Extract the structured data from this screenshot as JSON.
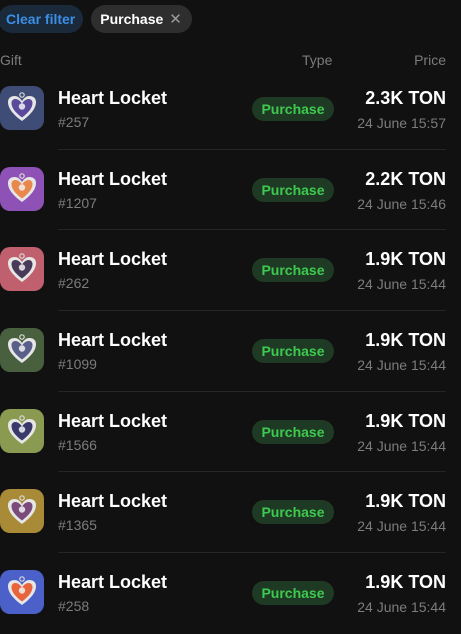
{
  "filters": {
    "clear_label": "Clear filter",
    "active_label": "Purchase",
    "remove_symbol": "✕"
  },
  "table": {
    "headers": {
      "gift": "Gift",
      "type": "Type",
      "price": "Price"
    },
    "rows": [
      {
        "name": "Heart Locket",
        "number": "#257",
        "type": "Purchase",
        "price": "2.3K TON",
        "date": "24 June 15:57",
        "thumb_bg": "#3f4c75",
        "heart": "#5a4a9c"
      },
      {
        "name": "Heart Locket",
        "number": "#1207",
        "type": "Purchase",
        "price": "2.2K TON",
        "date": "24 June 15:46",
        "thumb_bg": "#8e52b6",
        "heart": "#e8884c"
      },
      {
        "name": "Heart Locket",
        "number": "#262",
        "type": "Purchase",
        "price": "1.9K TON",
        "date": "24 June 15:44",
        "thumb_bg": "#c0606e",
        "heart": "#4a3a5a"
      },
      {
        "name": "Heart Locket",
        "number": "#1099",
        "type": "Purchase",
        "price": "1.9K TON",
        "date": "24 June 15:44",
        "thumb_bg": "#49603f",
        "heart": "#5a5f8a"
      },
      {
        "name": "Heart Locket",
        "number": "#1566",
        "type": "Purchase",
        "price": "1.9K TON",
        "date": "24 June 15:44",
        "thumb_bg": "#8a9a50",
        "heart": "#3a3a6a"
      },
      {
        "name": "Heart Locket",
        "number": "#1365",
        "type": "Purchase",
        "price": "1.9K TON",
        "date": "24 June 15:44",
        "thumb_bg": "#a98a36",
        "heart": "#7a4a7a"
      },
      {
        "name": "Heart Locket",
        "number": "#258",
        "type": "Purchase",
        "price": "1.9K TON",
        "date": "24 June 15:44",
        "thumb_bg": "#4b60c8",
        "heart": "#e8643c"
      }
    ]
  },
  "colors": {
    "background": "#111111",
    "accent_blue": "#3a8ee6",
    "badge_green": "#3ec94f",
    "muted_text": "#7c7c7c"
  },
  "icons": {
    "thumb": "heart-locket-icon",
    "remove": "close-icon"
  }
}
